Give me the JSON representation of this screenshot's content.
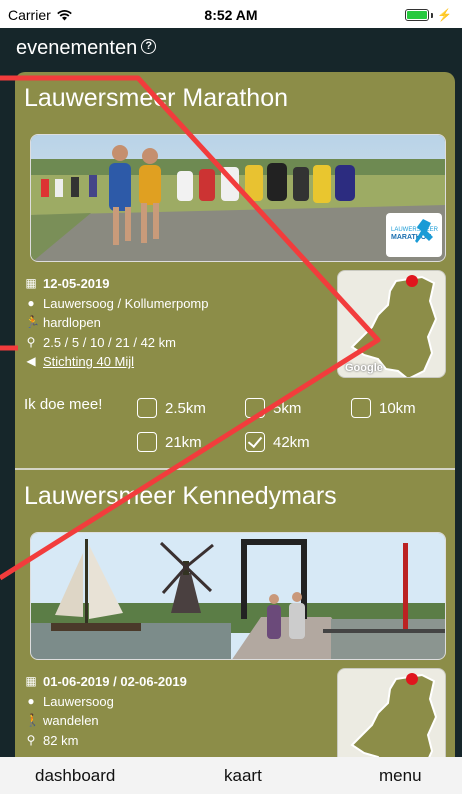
{
  "status_bar": {
    "carrier": "Carrier",
    "time": "8:52 AM"
  },
  "header": {
    "title": "evenementen",
    "help_icon": "?"
  },
  "events": [
    {
      "title": "Lauwersmeer Marathon",
      "date": "12-05-2019",
      "location": "Lauwersoog / Kollumerpomp",
      "activity": "hardlopen",
      "distances": "2.5 / 5 / 10 / 21 / 42 km",
      "organizer": "Stichting 40 Mijl",
      "photo_badge": [
        "LAUWERSMEER",
        "MARATHON"
      ],
      "map_attribution": "Google"
    },
    {
      "title": "Lauwersmeer Kennedymars",
      "date": "01-06-2019 / 02-06-2019",
      "location": "Lauwersoog",
      "activity": "wandelen",
      "distances": "82 km"
    }
  ],
  "participation": {
    "label": "Ik doe mee!",
    "options": [
      {
        "label": "2.5km",
        "checked": false
      },
      {
        "label": "5km",
        "checked": false
      },
      {
        "label": "10km",
        "checked": false
      },
      {
        "label": "21km",
        "checked": false
      },
      {
        "label": "42km",
        "checked": true
      }
    ]
  },
  "tabbar": {
    "dashboard": "dashboard",
    "map": "kaart",
    "menu": "menu"
  },
  "colors": {
    "card": "#8c8d48",
    "header_bg": "#16262a",
    "annotation": "#f23c3c"
  }
}
